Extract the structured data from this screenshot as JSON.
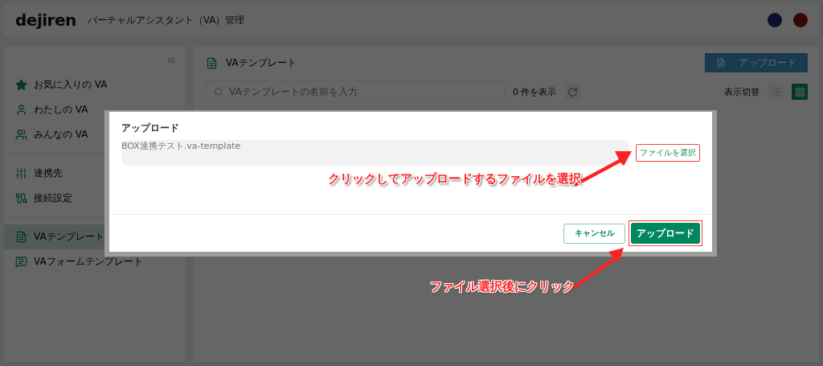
{
  "header": {
    "logo": "dejiren",
    "title": "バーチャルアシスタント（VA）管理"
  },
  "sidebar": {
    "groups": [
      {
        "items": [
          {
            "kind": "star",
            "label": "お気に入りの VA",
            "selected": false
          },
          {
            "kind": "person",
            "label": "わたしの VA",
            "selected": false
          },
          {
            "kind": "people",
            "label": "みんなの VA",
            "selected": false
          }
        ]
      },
      {
        "items": [
          {
            "kind": "sliders",
            "label": "連携先",
            "selected": false
          },
          {
            "kind": "connection",
            "label": "接続設定",
            "selected": false
          }
        ]
      },
      {
        "items": [
          {
            "kind": "template",
            "label": "VAテンプレート",
            "selected": true
          },
          {
            "kind": "form",
            "label": "VAフォームテンプレート",
            "selected": false
          }
        ]
      }
    ]
  },
  "main": {
    "title": "VAテンプレート",
    "upload_button": "アップロード",
    "search": {
      "placeholder": "VAテンプレートの名前を入力"
    },
    "count": "0 件を表示",
    "view_label": "表示切替",
    "views": [
      {
        "kind": "list",
        "selected": false
      },
      {
        "kind": "grid",
        "selected": true
      }
    ]
  },
  "dialog": {
    "title": "アップロード",
    "file_name": "BOX連携テスト.va-template",
    "choose_button": "ファイルを選択",
    "cancel_button": "キャンセル",
    "submit_button": "アップロード"
  },
  "annotations": [
    {
      "text": "クリックしてアップロードするファイルを選択"
    },
    {
      "text": "ファイル選択後にクリック"
    }
  ]
}
